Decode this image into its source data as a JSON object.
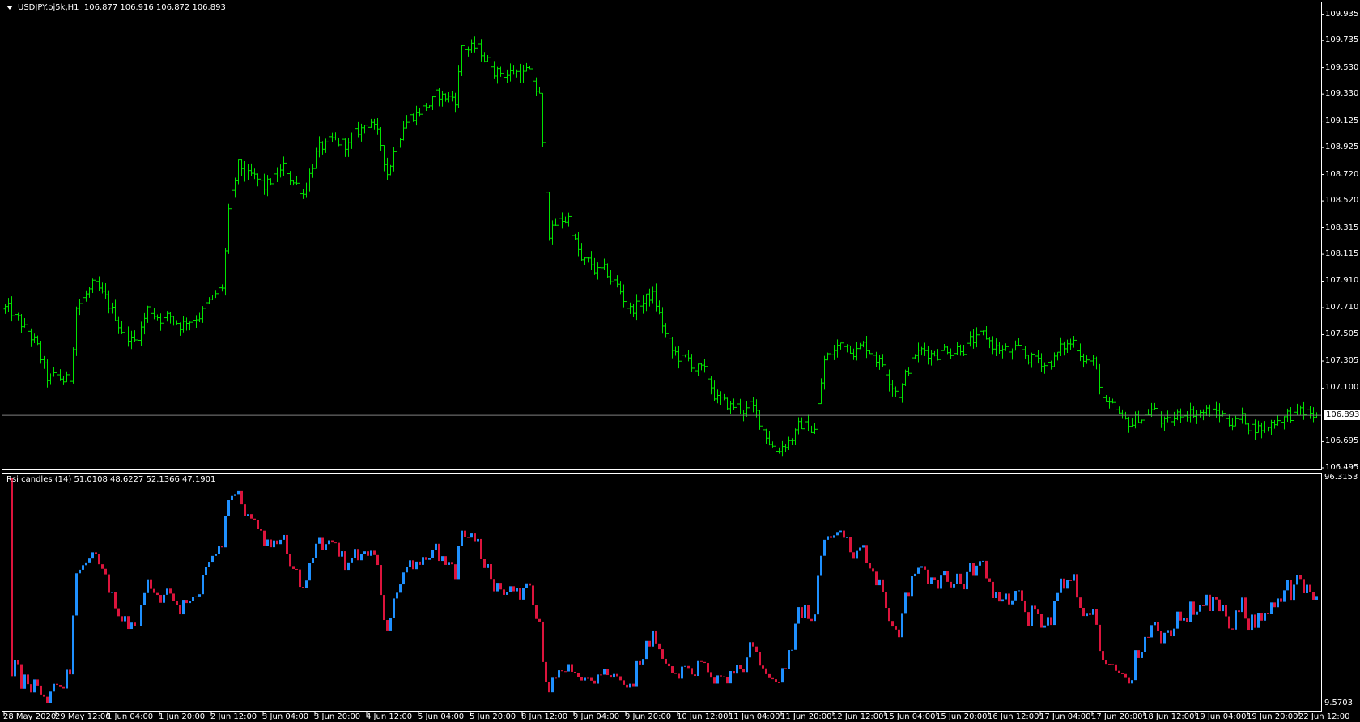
{
  "header": {
    "symbol": "USDJPY.oj5k,H1",
    "ohlc": "106.877 106.916 106.872 106.893"
  },
  "indicator": {
    "title": "Rsi candles (14) 51.0108 48.6227 52.1366 47.1901",
    "axis_max": "96.3153",
    "axis_min": "9.5703"
  },
  "current_price": "106.893",
  "colors": {
    "price_bar": "#00e400",
    "rsi_up": "#1e90ff",
    "rsi_down": "#dc143c",
    "frame": "#ffffff",
    "price_line": "#808080"
  },
  "chart_data": {
    "type": "ohlc",
    "timeframe": "H1",
    "last_bar": {
      "open": 106.877,
      "high": 106.916,
      "low": 106.872,
      "close": 106.893
    },
    "ylim": [
      106.495,
      109.935
    ],
    "price_ticks": [
      "109.935",
      "109.735",
      "109.530",
      "109.330",
      "109.125",
      "108.925",
      "108.720",
      "108.520",
      "108.315",
      "108.115",
      "107.910",
      "107.710",
      "107.505",
      "107.305",
      "107.100",
      "106.695",
      "106.495"
    ],
    "time_ticks": [
      "28 May 2020",
      "29 May 12:00",
      "1 Jun 04:00",
      "1 Jun 20:00",
      "2 Jun 12:00",
      "3 Jun 04:00",
      "3 Jun 20:00",
      "4 Jun 12:00",
      "5 Jun 04:00",
      "5 Jun 20:00",
      "8 Jun 12:00",
      "9 Jun 04:00",
      "9 Jun 20:00",
      "10 Jun 12:00",
      "11 Jun 04:00",
      "11 Jun 20:00",
      "12 Jun 12:00",
      "15 Jun 04:00",
      "15 Jun 20:00",
      "16 Jun 12:00",
      "17 Jun 04:00",
      "17 Jun 20:00",
      "18 Jun 12:00",
      "19 Jun 04:00",
      "19 Jun 20:00",
      "22 Jun 12:00"
    ],
    "bars_per_tick": 16,
    "bar_count": 406,
    "price_path": [
      [
        0,
        107.7
      ],
      [
        9,
        107.45
      ],
      [
        13,
        107.15
      ],
      [
        20,
        107.15
      ],
      [
        22,
        107.75
      ],
      [
        27,
        107.85
      ],
      [
        35,
        107.6
      ],
      [
        40,
        107.45
      ],
      [
        44,
        107.7
      ],
      [
        54,
        107.6
      ],
      [
        64,
        107.75
      ],
      [
        67,
        107.85
      ],
      [
        69,
        108.4
      ],
      [
        72,
        108.75
      ],
      [
        80,
        108.6
      ],
      [
        86,
        108.75
      ],
      [
        92,
        108.6
      ],
      [
        96,
        108.9
      ],
      [
        107,
        108.95
      ],
      [
        113,
        109.15
      ],
      [
        118,
        108.75
      ],
      [
        123,
        109.15
      ],
      [
        134,
        109.3
      ],
      [
        139,
        109.3
      ],
      [
        141,
        109.7
      ],
      [
        146,
        109.65
      ],
      [
        153,
        109.5
      ],
      [
        161,
        109.5
      ],
      [
        165,
        109.3
      ],
      [
        166,
        108.9
      ],
      [
        168,
        108.3
      ],
      [
        174,
        108.4
      ],
      [
        178,
        108.05
      ],
      [
        188,
        107.9
      ],
      [
        193,
        107.7
      ],
      [
        200,
        107.8
      ],
      [
        206,
        107.35
      ],
      [
        214,
        107.25
      ],
      [
        222,
        106.95
      ],
      [
        230,
        106.95
      ],
      [
        238,
        106.65
      ],
      [
        246,
        106.8
      ],
      [
        250,
        106.8
      ],
      [
        253,
        107.3
      ],
      [
        259,
        107.45
      ],
      [
        268,
        107.4
      ],
      [
        276,
        107.1
      ],
      [
        281,
        107.35
      ],
      [
        297,
        107.45
      ],
      [
        303,
        107.45
      ],
      [
        311,
        107.35
      ],
      [
        322,
        107.3
      ],
      [
        330,
        107.45
      ],
      [
        336,
        107.3
      ],
      [
        340,
        106.95
      ],
      [
        346,
        106.8
      ],
      [
        354,
        106.95
      ],
      [
        359,
        106.8
      ],
      [
        365,
        106.95
      ],
      [
        375,
        106.9
      ],
      [
        389,
        106.8
      ],
      [
        394,
        106.9
      ],
      [
        405,
        106.893
      ]
    ],
    "rsi_period": 14,
    "rsi_ylim": [
      9.5703,
      96.3153
    ]
  }
}
